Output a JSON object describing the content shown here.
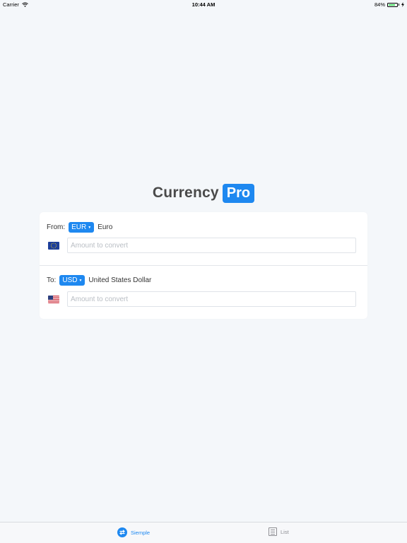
{
  "status_bar": {
    "carrier": "Carrier",
    "time": "10:44 AM",
    "battery": "84%",
    "battery_level": 0.84,
    "battery_color": "#4cd964"
  },
  "app": {
    "title_text": "Currency",
    "title_badge": "Pro",
    "accent_color": "#1e88f0"
  },
  "from": {
    "label": "From:",
    "code": "EUR",
    "name": "Euro",
    "flag_icon": "eu-flag-icon",
    "input_value": "",
    "input_placeholder": "Amount to convert"
  },
  "to": {
    "label": "To:",
    "code": "USD",
    "name": "United States Dollar",
    "flag_icon": "us-flag-icon",
    "input_value": "",
    "input_placeholder": "Amount to convert"
  },
  "tabs": [
    {
      "label": "Siemple",
      "icon": "swap-arrows-icon",
      "active": true
    },
    {
      "label": "List",
      "icon": "list-icon",
      "active": false
    }
  ]
}
